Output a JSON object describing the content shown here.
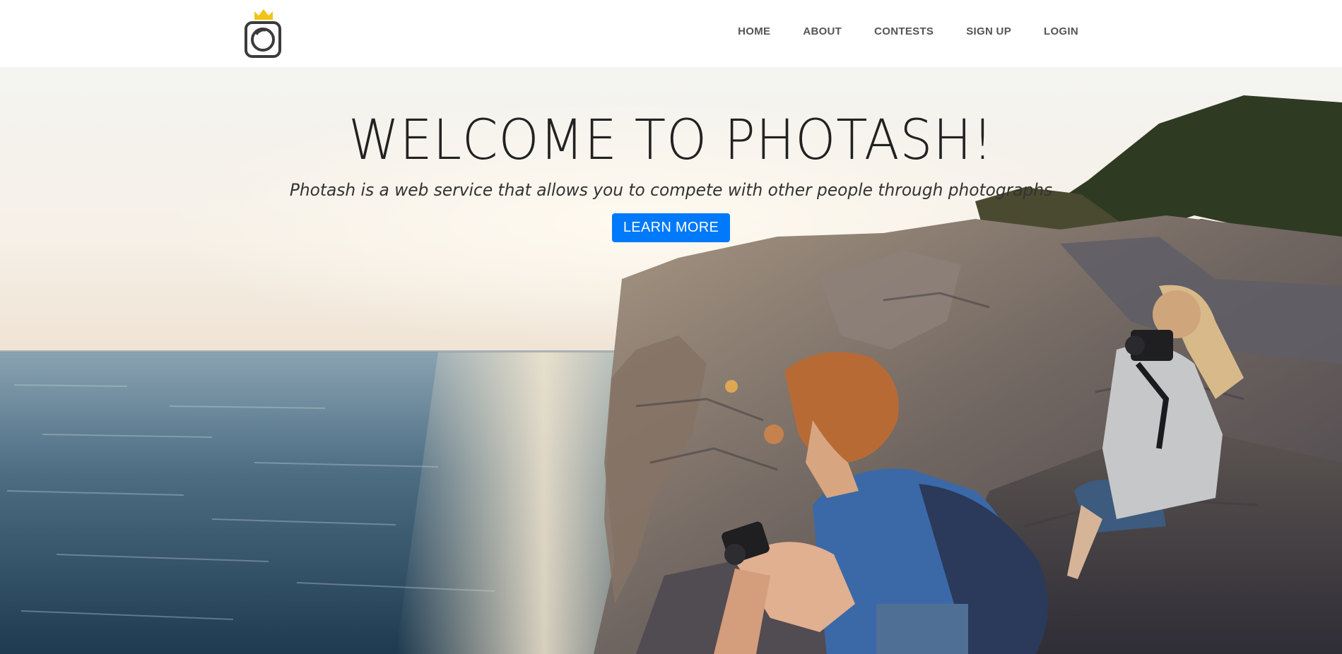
{
  "nav": {
    "logo_icon": "camera-crown-icon",
    "items": [
      {
        "label": "HOME"
      },
      {
        "label": "ABOUT"
      },
      {
        "label": "CONTESTS"
      },
      {
        "label": "SIGN UP"
      },
      {
        "label": "LOGIN"
      }
    ]
  },
  "hero": {
    "title": "WELCOME TO PHOTASH!",
    "tagline": "Photash is a web service that allows you to compete with other people through photographs",
    "cta_label": "LEARN MORE",
    "background_icon": "seaside-photographers-photo"
  },
  "colors": {
    "accent": "#0079fa",
    "crown": "#f2c418",
    "nav_text": "#555555",
    "title_text": "#222222"
  }
}
